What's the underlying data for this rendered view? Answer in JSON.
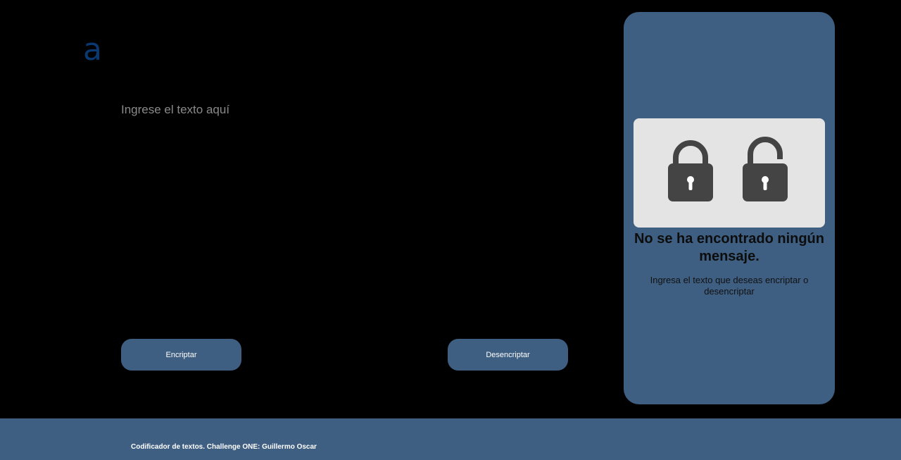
{
  "header": {
    "logo_text": "a"
  },
  "editor": {
    "placeholder": "Ingrese el texto aquí",
    "value": ""
  },
  "actions": {
    "encrypt_label": "Encriptar",
    "decrypt_label": "Desencriptar"
  },
  "output_panel": {
    "illustration_icons": [
      "lock-closed-icon",
      "lock-open-icon"
    ],
    "title": "No se ha encontrado ningún mensaje.",
    "description": "Ingresa el texto que deseas encriptar o desencriptar"
  },
  "footer": {
    "text": "Codificador de textos. Challenge ONE: Guillermo Oscar"
  },
  "colors": {
    "background": "#000000",
    "accent": "#3e5f82",
    "logo": "#0a3871",
    "illustration_bg": "#e4e4e4",
    "lock": "#444444"
  }
}
